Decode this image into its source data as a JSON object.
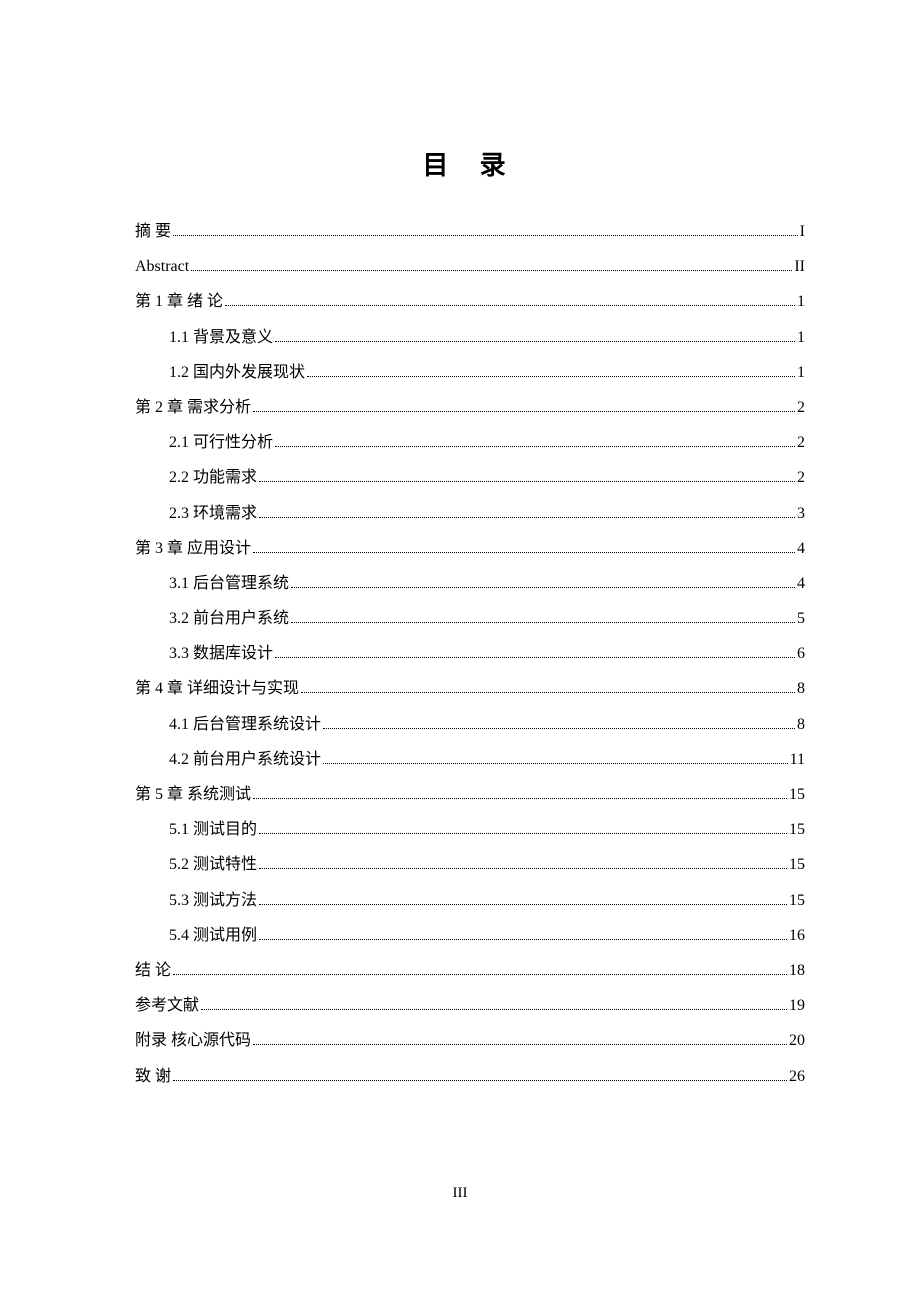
{
  "title": "目  录",
  "pageNumber": "III",
  "toc": [
    {
      "level": 1,
      "label": "摘   要",
      "page": "I"
    },
    {
      "level": 1,
      "label": "Abstract",
      "page": "II"
    },
    {
      "level": 1,
      "label": "第 1 章  绪  论",
      "page": "1"
    },
    {
      "level": 2,
      "label": "1.1  背景及意义",
      "page": "1"
    },
    {
      "level": 2,
      "label": "1.2  国内外发展现状",
      "page": "1"
    },
    {
      "level": 1,
      "label": "第 2 章  需求分析",
      "page": "2"
    },
    {
      "level": 2,
      "label": "2.1  可行性分析",
      "page": "2"
    },
    {
      "level": 2,
      "label": "2.2  功能需求",
      "page": "2"
    },
    {
      "level": 2,
      "label": "2.3  环境需求",
      "page": "3"
    },
    {
      "level": 1,
      "label": "第 3 章  应用设计",
      "page": "4"
    },
    {
      "level": 2,
      "label": "3.1  后台管理系统",
      "page": "4"
    },
    {
      "level": 2,
      "label": "3.2  前台用户系统",
      "page": "5"
    },
    {
      "level": 2,
      "label": "3.3  数据库设计",
      "page": "6"
    },
    {
      "level": 1,
      "label": "第 4 章  详细设计与实现",
      "page": "8"
    },
    {
      "level": 2,
      "label": "4.1  后台管理系统设计",
      "page": "8"
    },
    {
      "level": 2,
      "label": "4.2  前台用户系统设计",
      "page": "11"
    },
    {
      "level": 1,
      "label": "第 5 章  系统测试",
      "page": "15"
    },
    {
      "level": 2,
      "label": "5.1  测试目的",
      "page": "15"
    },
    {
      "level": 2,
      "label": "5.2  测试特性",
      "page": "15"
    },
    {
      "level": 2,
      "label": "5.3  测试方法",
      "page": "15"
    },
    {
      "level": 2,
      "label": "5.4  测试用例",
      "page": "16"
    },
    {
      "level": 1,
      "label": "结 论",
      "page": "18"
    },
    {
      "level": 1,
      "label": "参考文献",
      "page": "19"
    },
    {
      "level": 1,
      "label": "附录  核心源代码",
      "page": "20"
    },
    {
      "level": 1,
      "label": "致  谢",
      "page": "26"
    }
  ]
}
